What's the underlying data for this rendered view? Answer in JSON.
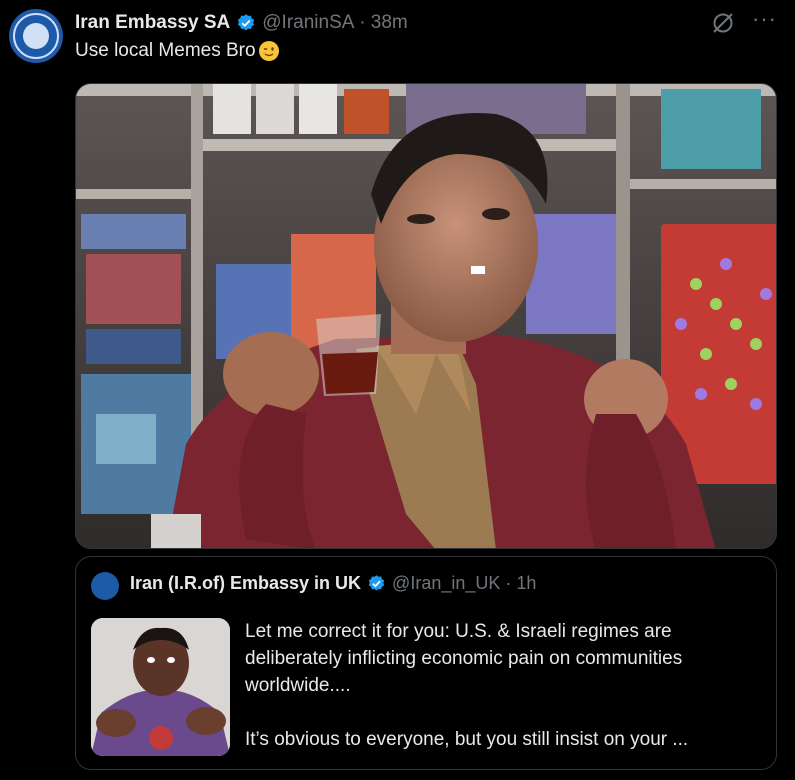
{
  "post": {
    "author_name": "Iran Embassy SA",
    "handle": "@IraninSA",
    "separator": "·",
    "time": "38m",
    "text": "Use local Memes Bro",
    "more_label": "···",
    "icons": [
      "verified-badge-icon",
      "grok-icon",
      "more-icon",
      "winking-face-emoji"
    ]
  },
  "quote": {
    "author_name": "Iran (I.R.of) Embassy in UK",
    "handle": "@Iran_in_UK",
    "separator": "·",
    "time": "1h",
    "text_p1": "Let me correct it for you: U.S. & Israeli regimes are deliberately inflicting economic pain on communities worldwide....",
    "text_p2": "It’s obvious to everyone, but you still insist on your ..."
  },
  "colors": {
    "background": "#000000",
    "text": "#e7e9ea",
    "muted": "#71767b",
    "verified": "#1d9bf0",
    "border": "#2f3336"
  }
}
